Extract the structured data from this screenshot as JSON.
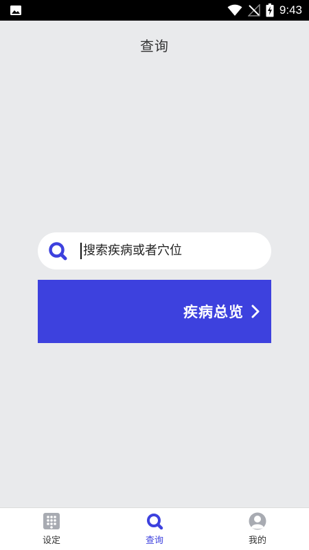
{
  "status_bar": {
    "time": "9:43",
    "icons": [
      "image-icon",
      "wifi-icon",
      "signal-off-icon",
      "battery-charging-icon"
    ]
  },
  "header": {
    "title": "查询"
  },
  "search": {
    "placeholder": "搜索疾病或者穴位",
    "icon": "search-icon"
  },
  "overview": {
    "label": "疾病总览",
    "icon": "chevron-right-icon"
  },
  "bottom_nav": {
    "items": [
      {
        "label": "设定",
        "icon": "keypad-icon",
        "active": false
      },
      {
        "label": "查询",
        "icon": "search-icon",
        "active": true
      },
      {
        "label": "我的",
        "icon": "avatar-icon",
        "active": false
      }
    ]
  },
  "colors": {
    "accent": "#3d41de",
    "background": "#e9eaec",
    "status_bar": "#000000",
    "inactive_icon": "#a8abb2"
  }
}
